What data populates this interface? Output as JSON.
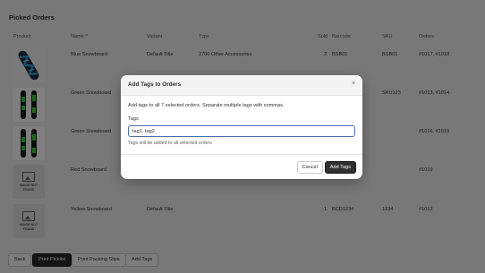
{
  "page": {
    "title": "Picked Orders"
  },
  "table": {
    "headers": {
      "product": "Product",
      "name": "Name",
      "sort_indicator": "^",
      "variant": "Variant",
      "type": "Type",
      "sold": "Sold",
      "barcode": "Barcode",
      "sku": "SKU",
      "orders": "Orders"
    },
    "rows": [
      {
        "image": "blue-snowboard",
        "name": "Blue Snowboard",
        "variant": "Default Title",
        "type": "2700 Other Accessories",
        "sold": "2",
        "barcode": "BSB01",
        "sku": "BSB01",
        "orders": "#1017, #1018"
      },
      {
        "image": "green-snowboard",
        "name": "Green Snowboard",
        "variant": "",
        "type": "",
        "sold": "",
        "barcode": "",
        "sku": "SKU123",
        "orders": "#1013, #1014"
      },
      {
        "image": "green-snowboard",
        "name": "Green Snowboard",
        "variant": "",
        "type": "",
        "sold": "",
        "barcode": "",
        "sku": "",
        "orders": "#1016, #1019"
      },
      {
        "image": "not-found",
        "image_text": "IMAGE NOT FOUND",
        "name": "Red Snowboard",
        "variant": "",
        "type": "",
        "sold": "",
        "barcode": "",
        "sku": "",
        "orders": "#1019"
      },
      {
        "image": "not-found",
        "image_text": "IMAGE NOT FOUND",
        "name": "Yellow Snowboard",
        "variant": "Default Title",
        "type": "",
        "sold": "1",
        "barcode": "BCD1234",
        "sku": "1234",
        "orders": "#1012"
      }
    ]
  },
  "footer": {
    "back": "Back",
    "print_picklist": "Print Picklist",
    "print_packing_slips": "Print Packing Slips",
    "add_tags": "Add Tags"
  },
  "modal": {
    "title": "Add Tags to Orders",
    "close": "×",
    "description": "Add tags to all 7 selected orders. Separate multiple tags with commas.",
    "tags_label": "Tags",
    "tags_value": "tag1, tag2",
    "help_text": "Tags will be added to all selected orders",
    "cancel": "Cancel",
    "submit": "Add Tags"
  },
  "colors": {
    "accent": "#303030",
    "input_focus": "#4a6fa5",
    "overlay": "#000000"
  },
  "icons": {
    "blue": "blue-snowboard-image",
    "green": "green-snowboard-image",
    "missing": "image-not-found-icon"
  }
}
